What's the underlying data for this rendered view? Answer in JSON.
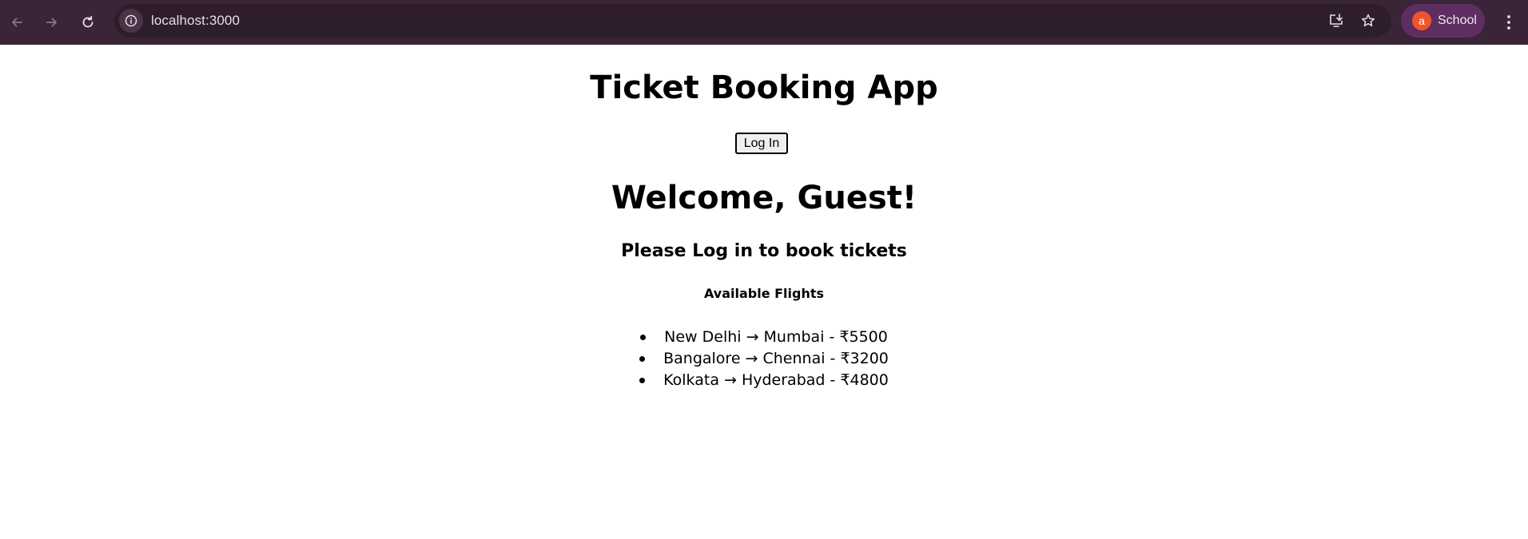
{
  "browser": {
    "url": "localhost:3000",
    "profile_initial": "a",
    "profile_name": "School",
    "colors": {
      "toolbar": "#3a2538",
      "omnibox": "#2e1e2c",
      "profile_chip": "#5e2e61",
      "avatar": "#f0542e"
    },
    "icons": [
      "back-arrow-icon",
      "forward-arrow-icon",
      "reload-icon",
      "info-icon",
      "install-app-icon",
      "star-icon",
      "kebab-menu-icon"
    ]
  },
  "page": {
    "title": "Ticket Booking App",
    "login_label": "Log In",
    "welcome": "Welcome, Guest!",
    "subtitle": "Please Log in to book tickets",
    "flights_heading": "Available Flights",
    "flights": [
      "New Delhi → Mumbai - ₹5500",
      "Bangalore → Chennai - ₹3200",
      "Kolkata → Hyderabad - ₹4800"
    ]
  }
}
